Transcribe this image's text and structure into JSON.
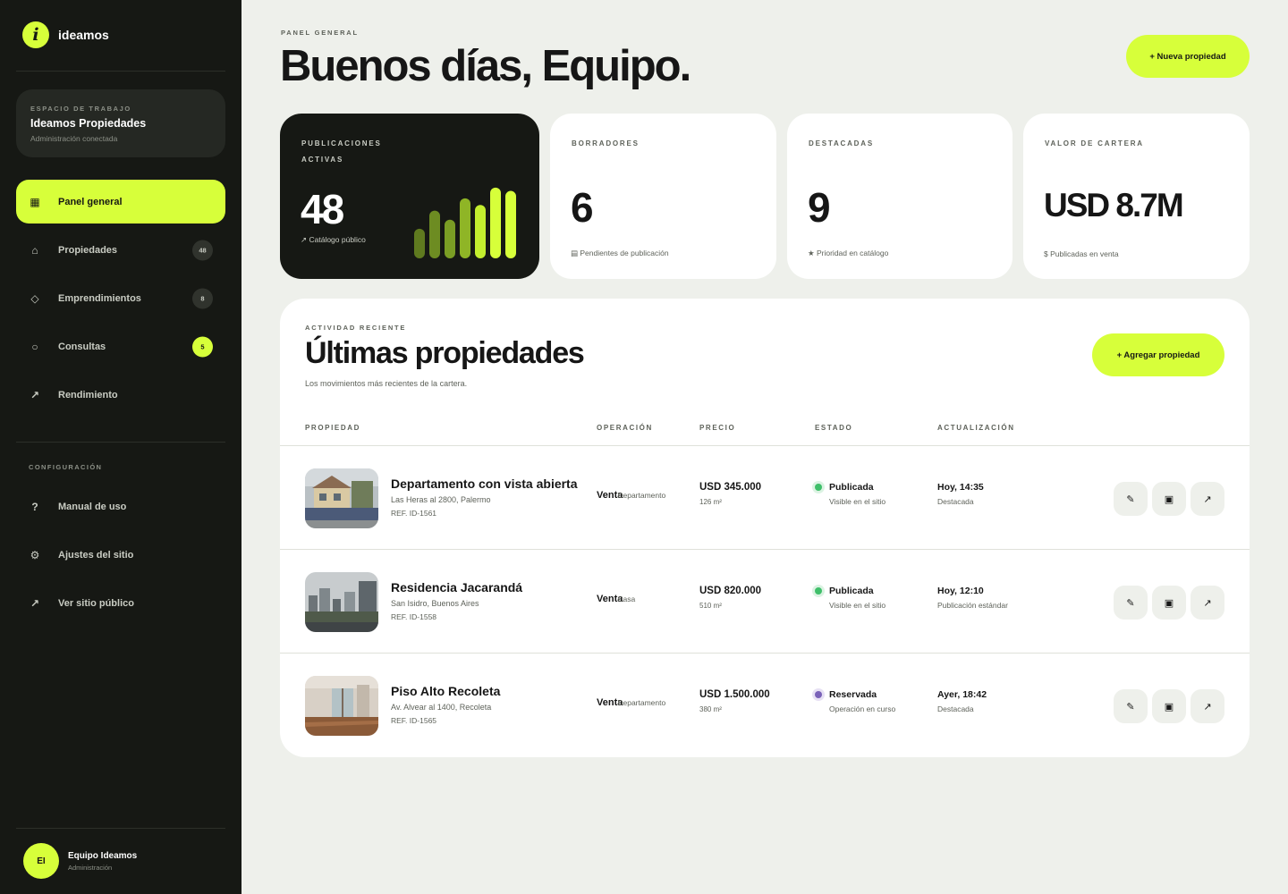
{
  "brand": {
    "name": "ideamos",
    "mark": "i"
  },
  "workspace": {
    "kicker": "ESPACIO DE TRABAJO",
    "name": "Ideamos Propiedades",
    "status": "Administración conectada"
  },
  "nav": [
    {
      "label": "Panel general",
      "icon": "grid-icon",
      "glyph": "▦",
      "badge": "",
      "active": true
    },
    {
      "label": "Propiedades",
      "icon": "house-icon",
      "glyph": "⌂",
      "badge": "48"
    },
    {
      "label": "Emprendimientos",
      "icon": "diamond-icon",
      "glyph": "◇",
      "badge": "8"
    },
    {
      "label": "Consultas",
      "icon": "circle-icon",
      "glyph": "○",
      "badge": "5"
    },
    {
      "label": "Rendimiento",
      "icon": "trend-arrow-icon",
      "glyph": "↗",
      "badge": ""
    }
  ],
  "config_section": "CONFIGURACIÓN",
  "nav_config": [
    {
      "label": "Manual de uso",
      "icon": "help-icon",
      "glyph": "?"
    },
    {
      "label": "Ajustes del sitio",
      "icon": "gear-icon",
      "glyph": "⚙"
    },
    {
      "label": "Ver sitio público",
      "icon": "external-arrow-icon",
      "glyph": "↗"
    }
  ],
  "user": {
    "initials": "EI",
    "name": "Equipo Ideamos",
    "role": "Administración"
  },
  "header": {
    "kicker": "PANEL GENERAL",
    "title": "Buenos días, Equipo.",
    "new_button": "+ Nueva propiedad"
  },
  "stats": [
    {
      "label": "PUBLICACIONES ACTIVAS",
      "value": "48",
      "note": "↗ Catálogo público",
      "bars": [
        0.36,
        0.58,
        0.47,
        0.73,
        0.65,
        0.86,
        0.82
      ]
    },
    {
      "label": "BORRADORES",
      "value": "6",
      "note": "▤ Pendientes de publicación"
    },
    {
      "label": "DESTACADAS",
      "value": "9",
      "note": "★ Prioridad en catálogo"
    },
    {
      "label": "VALOR DE CARTERA",
      "value": "USD 8.7M",
      "note": "$ Publicadas en venta"
    }
  ],
  "recent": {
    "kicker": "ACTIVIDAD RECIENTE",
    "title": "Últimas propiedades",
    "subtitle": "Los movimientos más recientes de la cartera.",
    "add_button": "+ Agregar propiedad",
    "columns": [
      "PROPIEDAD",
      "OPERACIÓN",
      "PRECIO",
      "ESTADO",
      "ACTUALIZACIÓN"
    ],
    "rows": [
      {
        "name": "Departamento con vista abierta",
        "address": "Las Heras al 2800, Palermo",
        "ref": "REF. ID-1561",
        "operation": "Venta",
        "type": "Departamento",
        "price": "USD 345.000",
        "area": "126 m²",
        "state": "Publicada",
        "state_desc": "Visible en el sitio",
        "state_color": "#3fbf6a",
        "updated": "Hoy, 14:35",
        "updated_desc": "Destacada"
      },
      {
        "name": "Residencia Jacarandá",
        "address": "San Isidro, Buenos Aires",
        "ref": "REF. ID-1558",
        "operation": "Venta",
        "type": "Casa",
        "price": "USD 820.000",
        "area": "510 m²",
        "state": "Publicada",
        "state_desc": "Visible en el sitio",
        "state_color": "#3fbf6a",
        "updated": "Hoy, 12:10",
        "updated_desc": "Publicación estándar"
      },
      {
        "name": "Piso Alto Recoleta",
        "address": "Av. Alvear al 1400, Recoleta",
        "ref": "REF. ID-1565",
        "operation": "Venta",
        "type": "Departamento",
        "price": "USD 1.500.000",
        "area": "380 m²",
        "state": "Reservada",
        "state_desc": "Operación en curso",
        "state_color": "#7a62b8",
        "updated": "Ayer, 18:42",
        "updated_desc": "Destacada"
      }
    ],
    "actions": [
      {
        "name": "edit",
        "glyph": "✎"
      },
      {
        "name": "view",
        "glyph": "▣"
      },
      {
        "name": "open",
        "glyph": "↗"
      }
    ]
  },
  "colors": {
    "accent": "#d7ff3a",
    "sidebar": "#161814",
    "background": "#eef0eb"
  }
}
